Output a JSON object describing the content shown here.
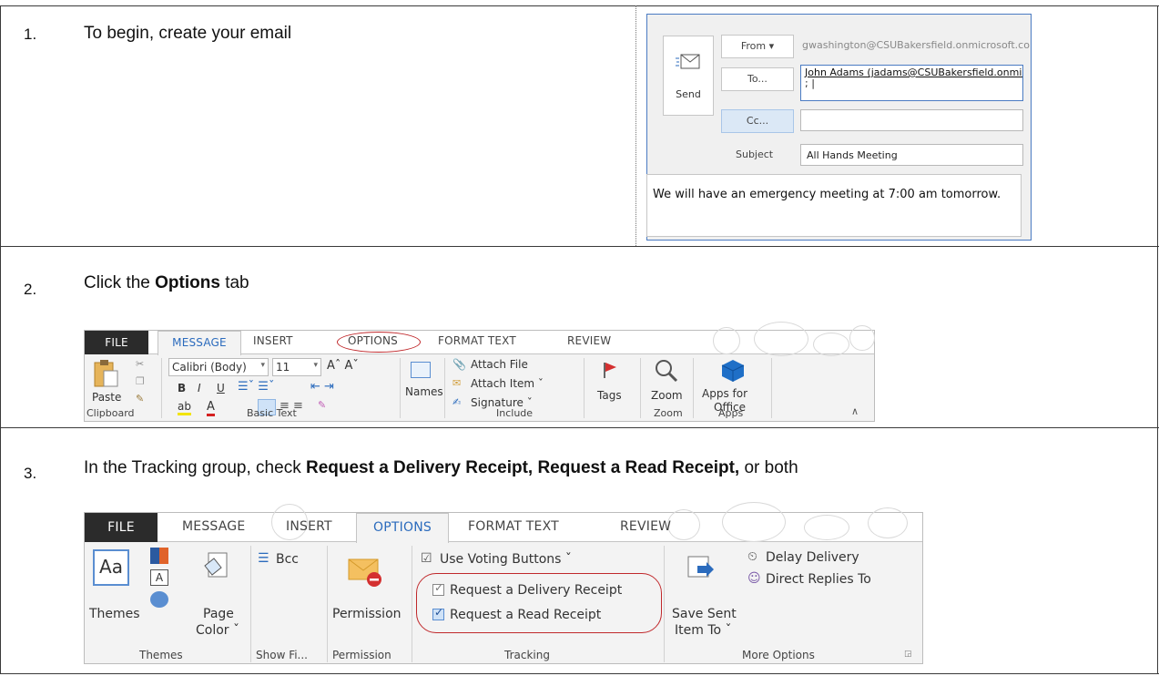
{
  "steps": [
    {
      "num": "1.",
      "text": "To begin, create your email"
    },
    {
      "num": "2.",
      "text_pre": "Click the ",
      "text_bold": "Options",
      "text_post": " tab"
    },
    {
      "num": "3.",
      "text_pre": "In the Tracking group, check ",
      "text_bold": "Request a Delivery Receipt, Request a Read Receipt,",
      "text_post": " or both"
    }
  ],
  "email": {
    "send_label": "Send",
    "from_label": "From ▾",
    "from_value": "gwashington@CSUBakersfield.onmicrosoft.co",
    "to_label": "To...",
    "to_value": "John Adams (jadams@CSUBakersfield.onmic",
    "to_value_line2": "; |",
    "cc_label": "Cc...",
    "cc_value": "",
    "subject_label": "Subject",
    "subject_value": "All Hands Meeting",
    "body": "We will have an emergency meeting at 7:00 am tomorrow."
  },
  "ribbon_message": {
    "tabs": [
      "FILE",
      "MESSAGE",
      "INSERT",
      "OPTIONS",
      "FORMAT TEXT",
      "REVIEW"
    ],
    "active_tab": "MESSAGE",
    "paste": "Paste",
    "font_name": "Calibri (Body)",
    "font_size": "11",
    "bold": "B",
    "italic": "I",
    "underline": "U",
    "names": "Names",
    "attach_file": "Attach File",
    "attach_item": "Attach Item ˇ",
    "signature": "Signature ˇ",
    "tags": "Tags",
    "zoom": "Zoom",
    "apps_for_office_line1": "Apps for",
    "apps_for_office_line2": "Office",
    "groups": [
      "Clipboard",
      "Basic Text",
      "Include",
      "Zoom",
      "Apps"
    ]
  },
  "ribbon_options": {
    "tabs": [
      "FILE",
      "MESSAGE",
      "INSERT",
      "OPTIONS",
      "FORMAT TEXT",
      "REVIEW"
    ],
    "active_tab": "OPTIONS",
    "themes": "Themes",
    "page_color_line1": "Page",
    "page_color_line2": "Color ˇ",
    "bcc": "Bcc",
    "permission": "Permission",
    "use_voting_buttons": "Use Voting Buttons ˇ",
    "request_delivery_receipt": "Request a Delivery Receipt",
    "request_read_receipt": "Request a Read Receipt",
    "delivery_receipt_checked": false,
    "read_receipt_checked": true,
    "save_sent_line1": "Save Sent",
    "save_sent_line2": "Item To ˇ",
    "delay_delivery": "Delay Delivery",
    "direct_replies_to": "Direct Replies To",
    "groups": [
      "Themes",
      "Show Fi...",
      "Permission",
      "Tracking",
      "More Options"
    ]
  },
  "colors": {
    "accent": "#2b6bbd",
    "highlight_red": "#c0282b",
    "file_tab": "#2b2b2b"
  }
}
